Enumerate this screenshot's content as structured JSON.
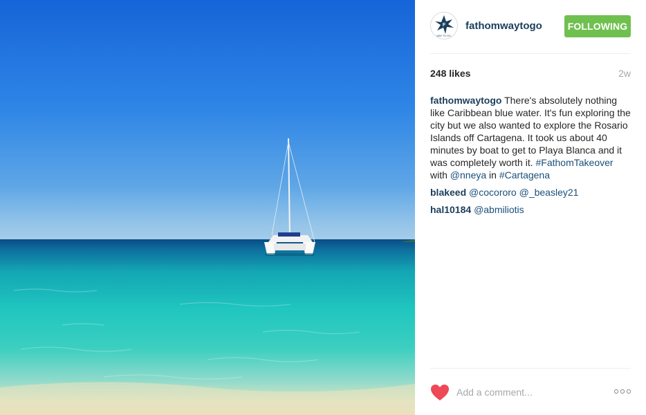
{
  "post": {
    "username": "fathomwaytogo",
    "avatar_text": "WAY TO GO.",
    "follow_label": "FOLLOWING",
    "likes": "248 likes",
    "age": "2w",
    "caption": {
      "user": "fathomwaytogo",
      "text1": " There's absolutely nothing like Caribbean blue water. It's fun exploring the city but we also wanted to explore the Rosario Islands off Cartagena. It took us about 40 minutes by boat to get to Playa Blanca and it was completely worth it. ",
      "hashtag1": "#FathomTakeover",
      "text2": " with ",
      "mention": "@nneya",
      "text3": " in ",
      "hashtag2": "#Cartagena"
    },
    "comments": [
      {
        "user": "blakeed",
        "text": "@cocororo @_beasley21"
      },
      {
        "user": "hal10184",
        "text": "@abmiliotis"
      }
    ],
    "comment_placeholder": "Add a comment...",
    "heart_color": "#ed4956",
    "follow_color": "#70c050"
  }
}
